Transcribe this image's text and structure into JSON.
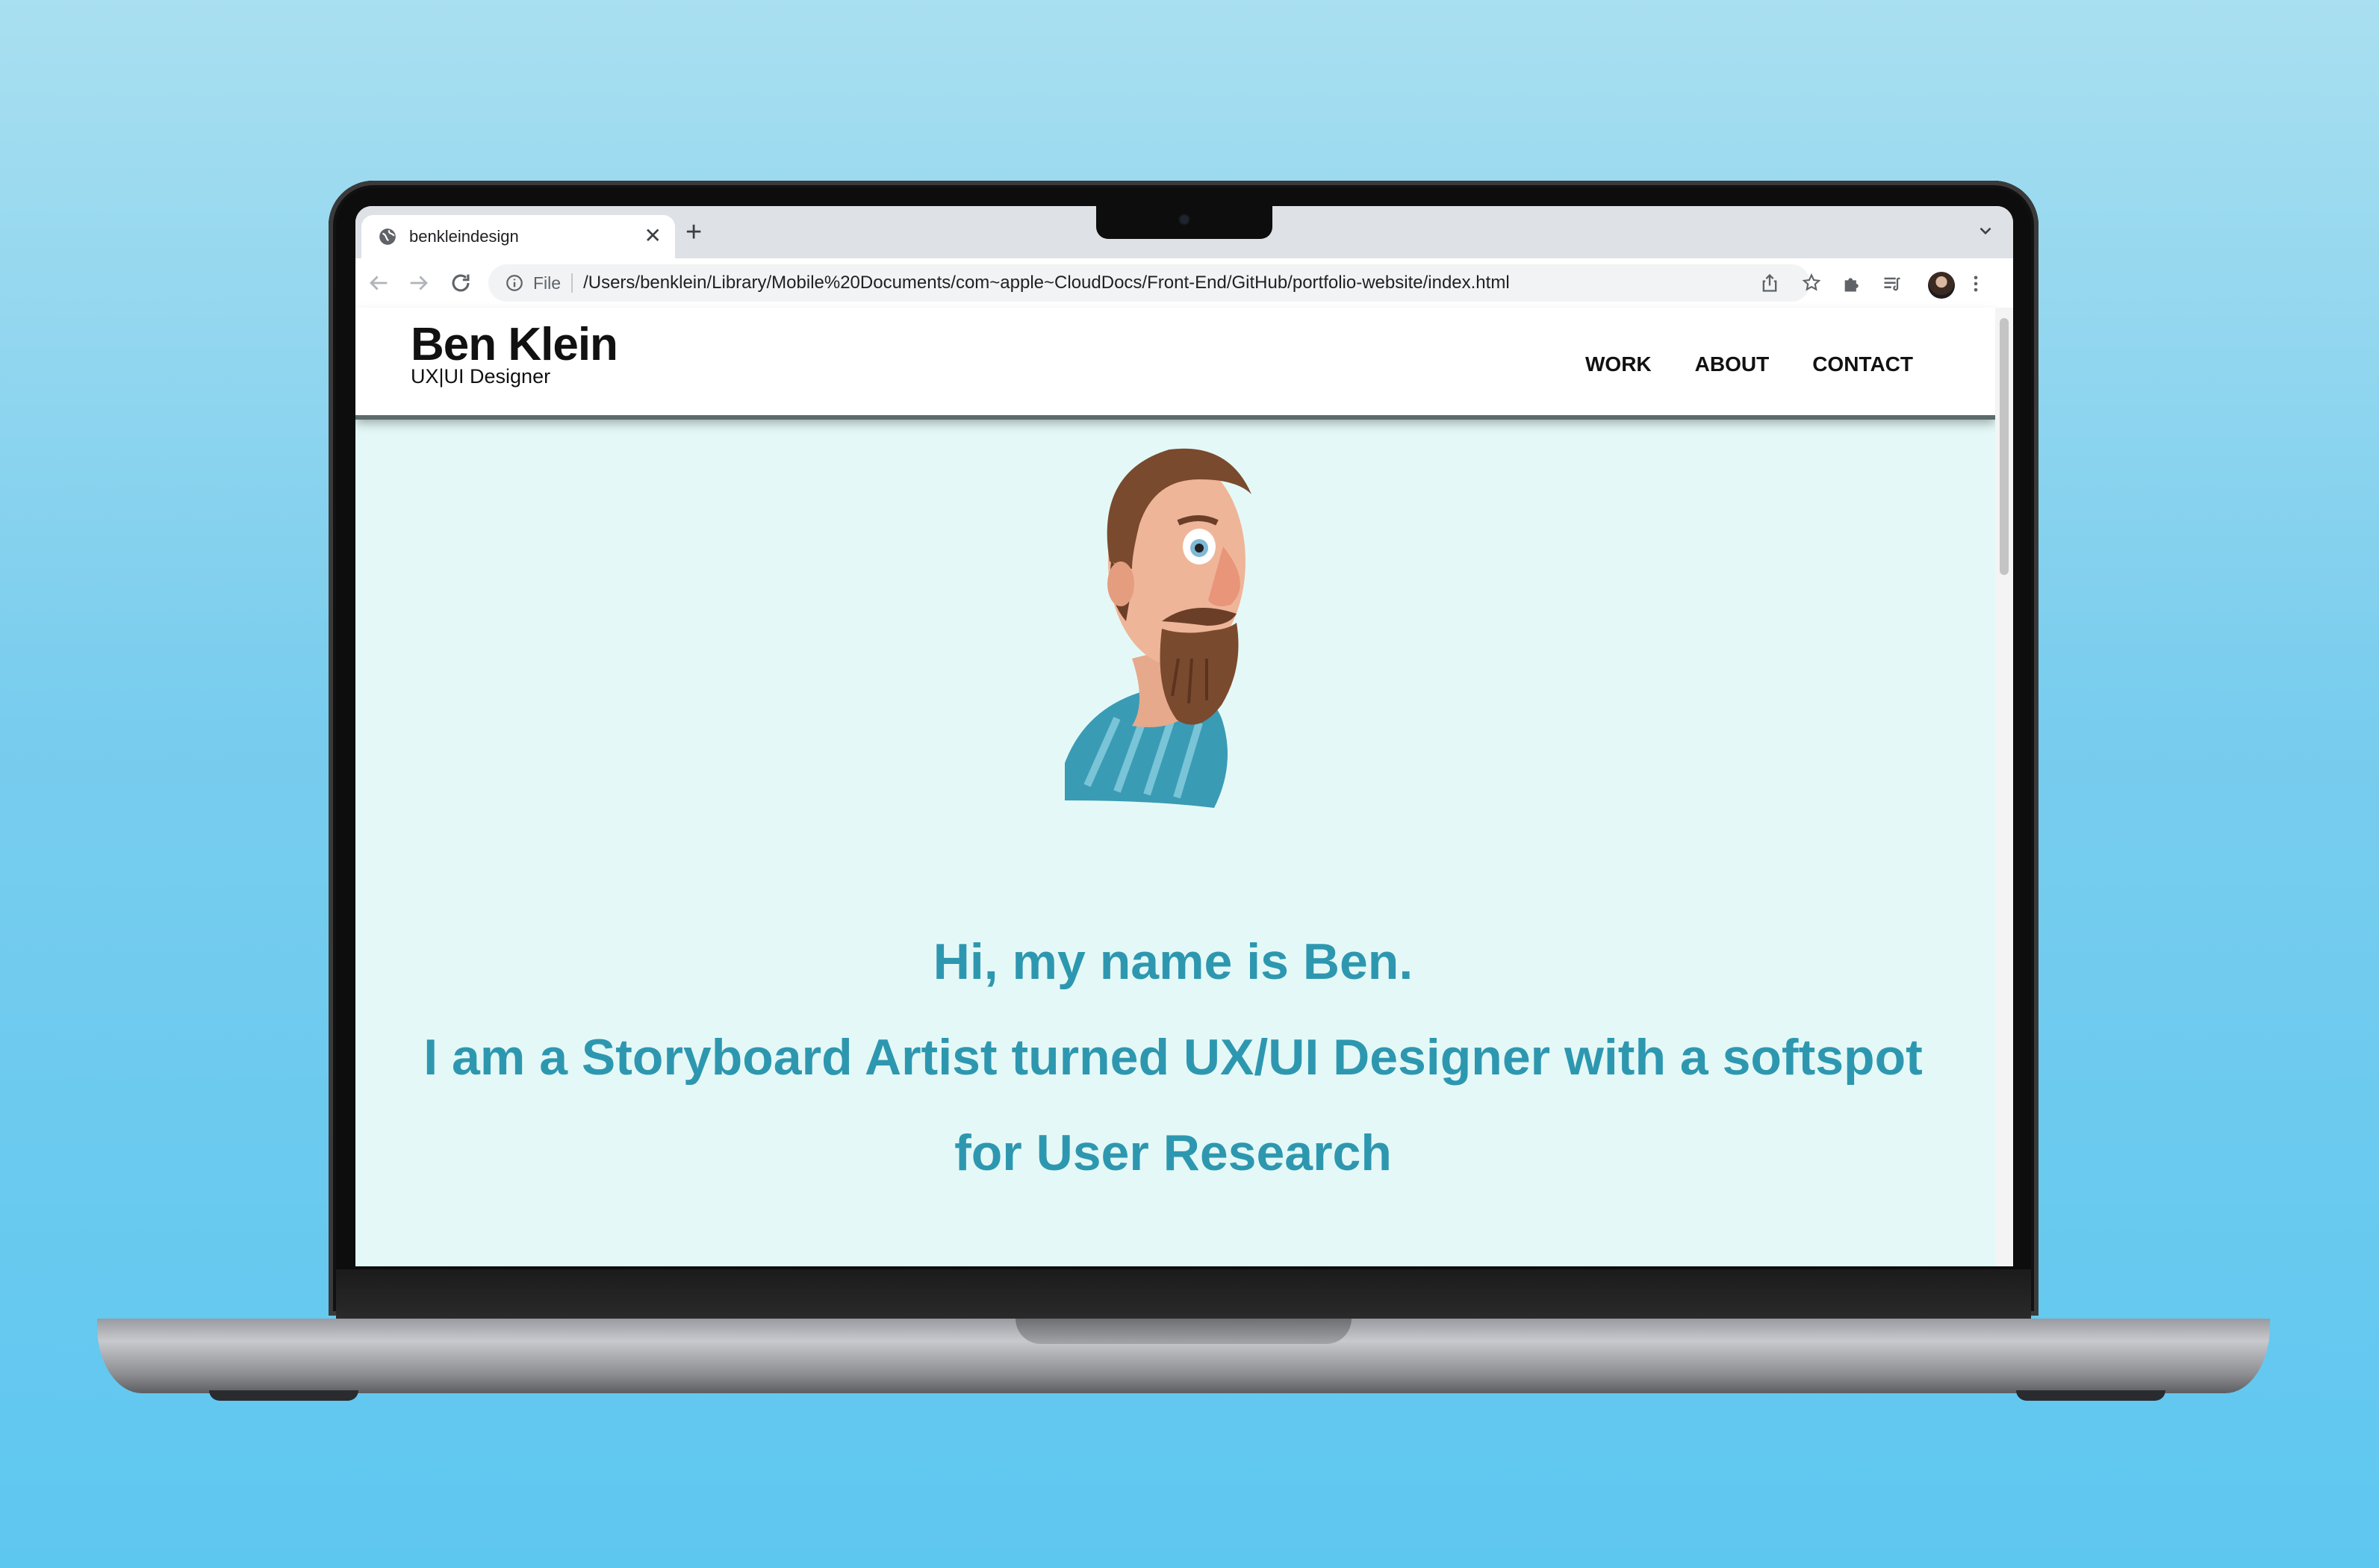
{
  "browser": {
    "tab_title": "benkleindesign",
    "tab_close": "✕",
    "new_tab": "+",
    "icons": [
      "globe-icon",
      "close-icon",
      "plus-icon",
      "chevron-down-icon",
      "back-icon",
      "forward-icon",
      "reload-icon",
      "info-icon",
      "share-icon",
      "star-icon",
      "puzzle-icon",
      "reading-list-icon",
      "avatar",
      "more-icon"
    ],
    "address": {
      "scheme_label": "File",
      "url": "/Users/benklein/Library/Mobile%20Documents/com~apple~CloudDocs/Front-End/GitHub/portfolio-website/index.html"
    }
  },
  "site": {
    "brand": {
      "name": "Ben Klein",
      "tagline": "UX|UI Designer"
    },
    "nav": {
      "work": "WORK",
      "about": "ABOUT",
      "contact": "CONTACT"
    },
    "hero": {
      "line1": "Hi, my name is Ben.",
      "line2": "I am a Storyboard Artist turned UX/UI Designer with a softspot for User Research"
    }
  },
  "colors": {
    "page_background": "#e4f9f7",
    "hero_text": "#2e97b0",
    "header_background": "#ffffff"
  }
}
